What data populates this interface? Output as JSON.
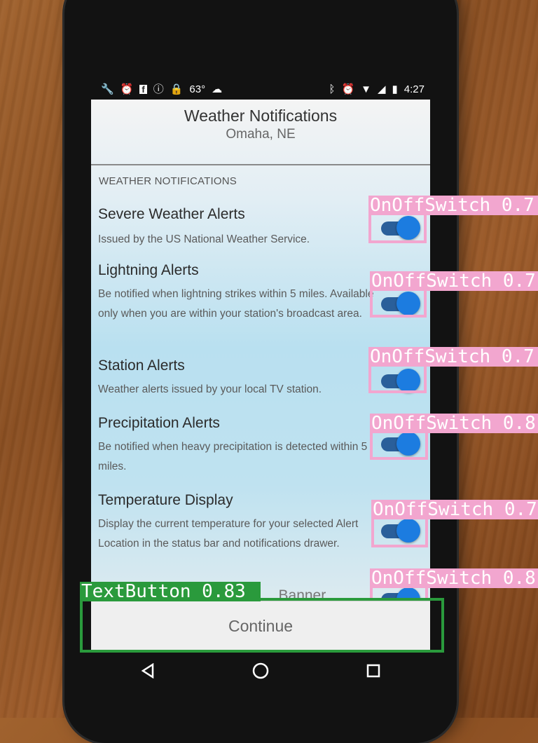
{
  "status_bar": {
    "left_icons": [
      "wrench-icon",
      "alarm-icon",
      "facebook-icon",
      "info-icon",
      "lock-icon"
    ],
    "temperature": "63°",
    "right_icons": [
      "bluetooth-icon",
      "alarm-icon",
      "wifi-icon",
      "signal-icon",
      "battery-icon"
    ],
    "time": "4:27"
  },
  "header": {
    "title": "Weather Notifications",
    "subtitle": "Omaha, NE"
  },
  "section_title": "WEATHER NOTIFICATIONS",
  "settings": [
    {
      "title": "Severe Weather Alerts",
      "description": "Issued by the US National Weather Service.",
      "enabled": true
    },
    {
      "title": "Lightning Alerts",
      "description": "Be notified when lightning strikes within 5 miles. Available only when you are within your station's broadcast area.",
      "enabled": true
    },
    {
      "title": "Station Alerts",
      "description": "Weather alerts issued by your local TV station.",
      "enabled": true
    },
    {
      "title": "Precipitation Alerts",
      "description": "Be notified when heavy precipitation is detected within 5 miles.",
      "enabled": true
    },
    {
      "title": "Temperature Display",
      "description": "Display the current temperature for your selected Alert Location in the status bar and notifications drawer.",
      "enabled": true
    },
    {
      "title": "...Banner",
      "description": "",
      "enabled": true
    }
  ],
  "continue_label": "Continue",
  "annotations": {
    "switch_labels": [
      "OnOffSwitch 0.7",
      "OnOffSwitch 0.7",
      "OnOffSwitch 0.7",
      "OnOffSwitch 0.8",
      "OnOffSwitch 0.7",
      "OnOffSwitch 0.8"
    ],
    "button_label": "TextButton 0.83"
  },
  "colors": {
    "switch_on": "#1c7ce0",
    "annotation_switch": "#f2a6cf",
    "annotation_button": "#2a9a3c"
  }
}
